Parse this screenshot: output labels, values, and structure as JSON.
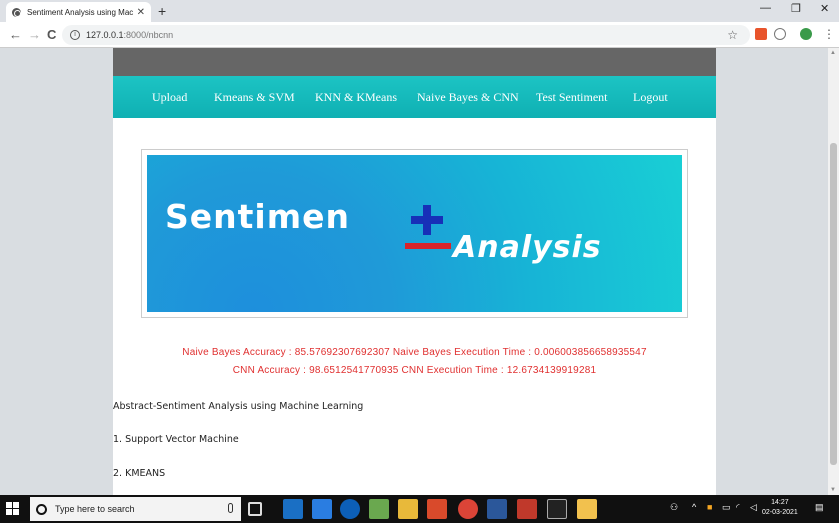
{
  "browser": {
    "tab_title": "Sentiment Analysis using Machin",
    "close_glyph": "✕",
    "new_tab_glyph": "+",
    "url_host": "127.0.0.1",
    "url_path": ":8000/nbcnn",
    "info_glyph": "i",
    "back_glyph": "←",
    "forward_glyph": "→",
    "reload_glyph": "C",
    "star_glyph": "☆",
    "menu_glyph": "⋮",
    "minimize_glyph": "—",
    "restore_glyph": "❐",
    "window_close_glyph": "✕"
  },
  "nav": {
    "items": [
      "Upload",
      "Kmeans & SVM",
      "KNN & KMeans",
      "Naive Bayes & CNN",
      "Test Sentiment",
      "Logout"
    ]
  },
  "banner": {
    "word1": "Sentimen",
    "word2": "Analysis"
  },
  "results": {
    "line1": "Naive Bayes Accuracy : 85.57692307692307 Naive Bayes Execution Time : 0.006003856658935547",
    "line2": "CNN Accuracy : 98.6512541770935 CNN Execution Time : 12.6734139919281"
  },
  "content": {
    "abstract": "Abstract-Sentiment Analysis using Machine Learning",
    "item1": "1. Support Vector Machine",
    "item2": "2. KMEANS"
  },
  "taskbar": {
    "search_placeholder": "Type here to search",
    "time": "14:27",
    "date": "02-03-2021"
  },
  "colors": {
    "nav_teal": "#12b9bb",
    "result_red": "#e03030"
  }
}
